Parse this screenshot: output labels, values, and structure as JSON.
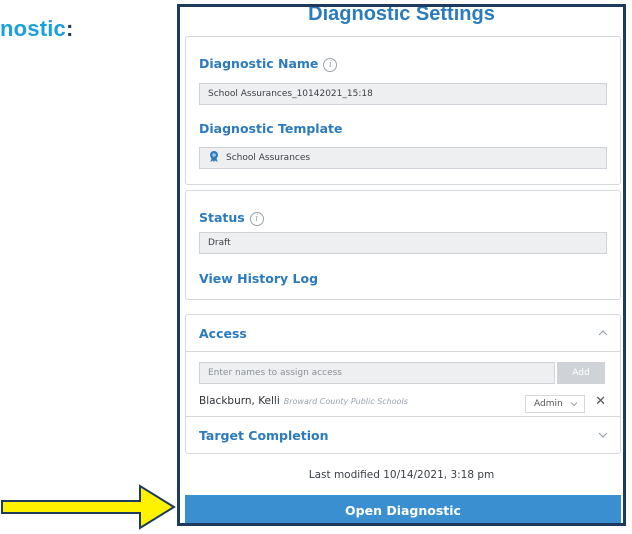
{
  "partial_heading": {
    "text": "nostic",
    "colon": ":"
  },
  "panel": {
    "title": "Diagnostic Settings"
  },
  "diagnostic": {
    "name_label": "Diagnostic Name",
    "name_value": "School Assurances_10142021_15:18",
    "template_label": "Diagnostic Template",
    "template_value": "School Assurances",
    "template_icon": "ribbon-badge-icon"
  },
  "status": {
    "label": "Status",
    "value": "Draft",
    "history_link": "View History Log"
  },
  "access": {
    "label": "Access",
    "input_placeholder": "Enter names to assign access",
    "add_label": "Add",
    "users": [
      {
        "name": "Blackburn, Kelli",
        "org": "Broward County Public Schools",
        "role": "Admin"
      }
    ]
  },
  "target": {
    "label": "Target Completion"
  },
  "footer": {
    "last_modified": "Last modified 10/14/2021, 3:18 pm",
    "open_label": "Open Diagnostic"
  },
  "colors": {
    "accent": "#2b7bbd",
    "button": "#3a8fd0",
    "arrow_fill": "#fff200",
    "arrow_stroke": "#1f3a5f"
  }
}
